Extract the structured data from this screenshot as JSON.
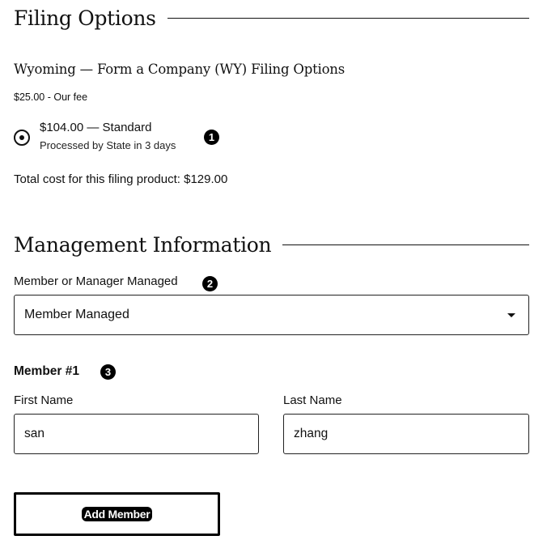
{
  "filing": {
    "section_title": "Filing Options",
    "subtitle": "Wyoming — Form a Company (WY) Filing Options",
    "fee": "$25.00 - Our fee",
    "option": {
      "selected": true,
      "label": "$104.00 — Standard",
      "sub": "Processed by State in 3 days"
    },
    "total": "Total cost for this filing product: $129.00"
  },
  "management": {
    "section_title": "Management Information",
    "type_label": "Member or Manager Managed",
    "type_value": "Member Managed",
    "member_title": "Member #1",
    "first_name_label": "First Name",
    "first_name_value": "san",
    "last_name_label": "Last Name",
    "last_name_value": "zhang",
    "add_member_label": "Add Member"
  },
  "badges": [
    "1",
    "2",
    "3"
  ]
}
